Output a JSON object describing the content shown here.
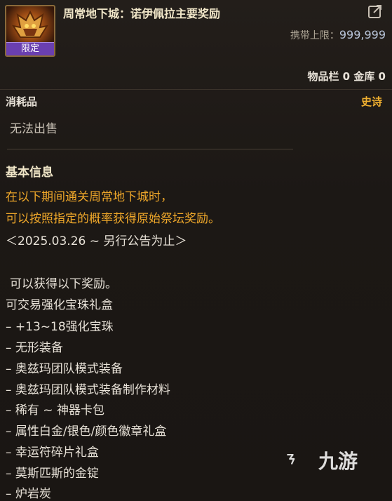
{
  "header": {
    "badge": "限定",
    "title": "周常地下城：诺伊佩拉主要奖励",
    "carry_label": "携带上限：",
    "carry_value": "999,999",
    "storage": "物品栏 0 金库 0"
  },
  "item": {
    "category": "消耗品",
    "rarity": "史诗",
    "rarity_color": "#f0b030",
    "sell_status": "无法出售"
  },
  "info": {
    "section_title": "基本信息",
    "desc_line1": "在以下期间通关周常地下城时，",
    "desc_line2": "可以按照指定的概率获得原始祭坛奖励。",
    "period": "＜2025.03.26 ~ 另行公告为止＞",
    "intro": "可以获得以下奖励。",
    "box_title": "可交易强化宝珠礼盒",
    "rewards": [
      "– +13~18强化宝珠",
      "– 无形装备",
      "– 奥兹玛团队模式装备",
      "– 奥兹玛团队模式装备制作材料",
      "– 稀有 ~ 神器卡包",
      "– 属性白金/银色/颜色徽章礼盒",
      "– 幸运符碎片礼盒",
      "– 莫斯匹斯的金锭",
      "– 炉岩炭"
    ]
  },
  "watermark": {
    "text": "九游"
  },
  "icons": {
    "item": "demon-crown-icon",
    "link": "share-link-icon",
    "watermark": "jiuyou-logo-icon"
  }
}
